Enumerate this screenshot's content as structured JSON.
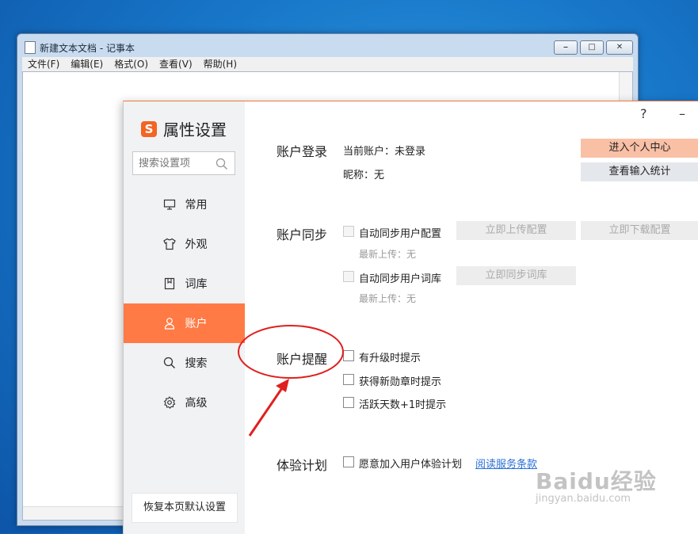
{
  "notepad": {
    "title": "新建文本文档 - 记事本",
    "menu": [
      "文件(F)",
      "编辑(E)",
      "格式(O)",
      "查看(V)",
      "帮助(H)"
    ],
    "controls": [
      "minimize-icon",
      "maximize-icon",
      "close-icon"
    ]
  },
  "dialog": {
    "brand": "属性设置",
    "search_placeholder": "搜索设置项",
    "nav": [
      {
        "label": "常用",
        "icon": "monitor-icon"
      },
      {
        "label": "外观",
        "icon": "shirt-icon"
      },
      {
        "label": "词库",
        "icon": "dictionary-icon"
      },
      {
        "label": "账户",
        "icon": "user-icon",
        "active": true
      },
      {
        "label": "搜索",
        "icon": "search-icon"
      },
      {
        "label": "高级",
        "icon": "gear-icon"
      }
    ],
    "restore_label": "恢复本页默认设置",
    "help_label": "?",
    "minimize_label": "–"
  },
  "account_login": {
    "title": "账户登录",
    "current_account": "当前账户：未登录",
    "nickname": "昵称：无",
    "btn_profile": "进入个人中心",
    "btn_stats": "查看输入统计"
  },
  "account_sync": {
    "title": "账户同步",
    "sync_config": "自动同步用户配置",
    "last_upload_1": "最新上传：无",
    "btn_upload_config": "立即上传配置",
    "btn_download_config": "立即下载配置",
    "sync_dict": "自动同步用户词库",
    "last_upload_2": "最新上传：无",
    "btn_sync_dict": "立即同步词库"
  },
  "account_reminder": {
    "title": "账户提醒",
    "opt1": "有升级时提示",
    "opt2": "获得新勋章时提示",
    "opt3": "活跃天数+1时提示"
  },
  "experience": {
    "title": "体验计划",
    "opt": "愿意加入用户体验计划",
    "link": "阅读服务条款"
  },
  "watermark": {
    "text": "Baidu经验",
    "sub": "jingyan.baidu.com"
  },
  "colors": {
    "accent": "#ff7a45",
    "annotation": "#e0201e"
  }
}
